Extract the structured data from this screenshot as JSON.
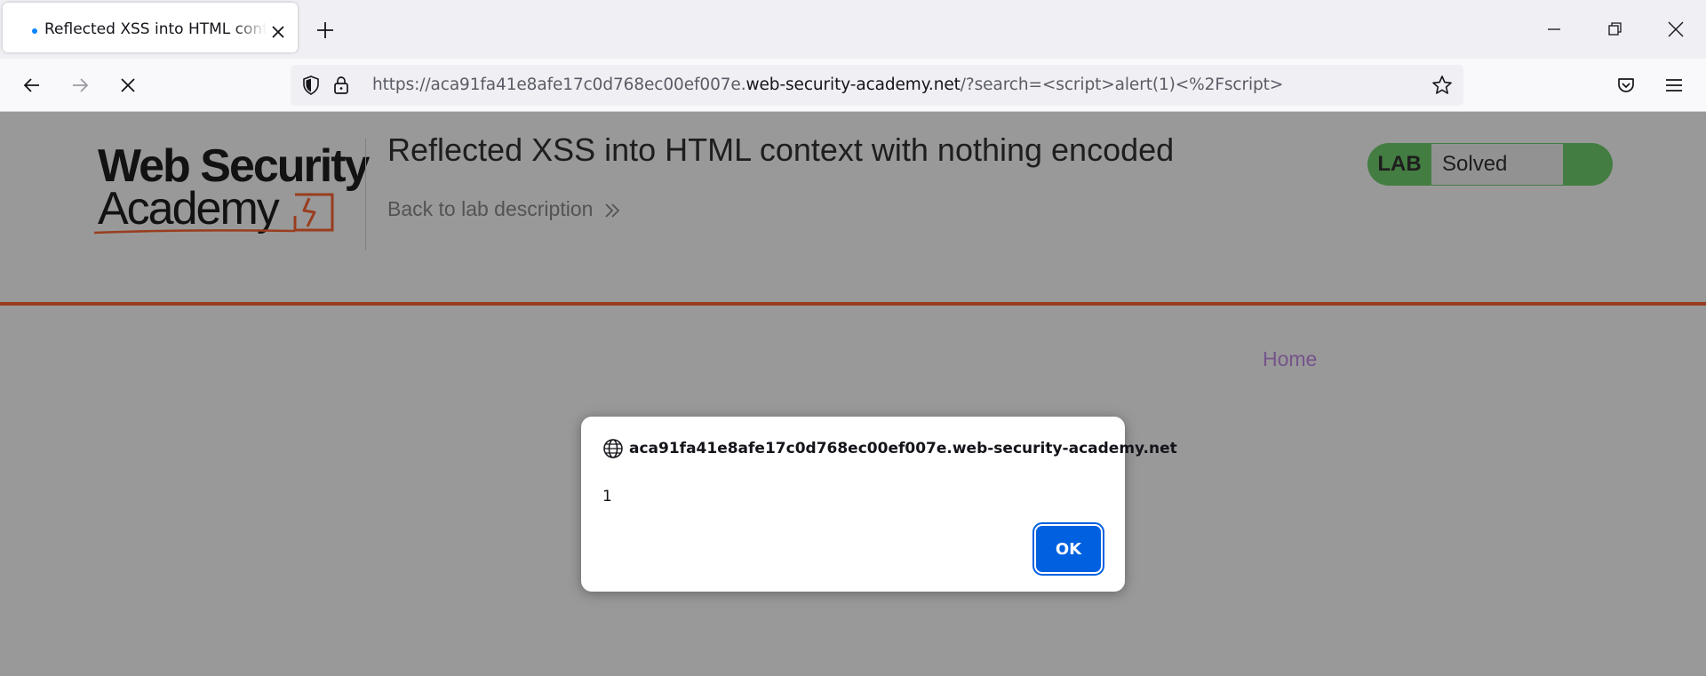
{
  "browser": {
    "tab": {
      "title": "Reflected XSS into HTML context with nothing encoded"
    },
    "url": {
      "prefix": "https://aca91fa41e8afe17c0d768ec00ef007e.",
      "host": "web-security-academy.net",
      "path": "/?search=<script>alert(1)<%2Fscript>"
    },
    "icons": [
      "back-icon",
      "forward-icon",
      "stop-icon",
      "shield-icon",
      "lock-icon",
      "bookmark-star-icon",
      "pocket-icon",
      "menu-icon",
      "new-tab-icon",
      "minimize-icon",
      "restore-icon",
      "close-icon"
    ]
  },
  "page": {
    "logo": {
      "line1": "Web Security",
      "line2": "Academy"
    },
    "lab_title": "Reflected XSS into HTML context with nothing encoded",
    "back_link": "Back to lab description",
    "badge": {
      "label": "LAB",
      "status": "Solved"
    },
    "nav": {
      "home": "Home"
    }
  },
  "dialog": {
    "origin": "aca91fa41e8afe17c0d768ec00ef007e.web-security-academy.net",
    "message": "1",
    "ok_label": "OK"
  },
  "colors": {
    "accent": "#ff6633",
    "badge_green": "#70d16d",
    "home_link": "#c58ce8",
    "ok_button": "#0061e0",
    "tab_loading_dot": "#0a84ff"
  }
}
